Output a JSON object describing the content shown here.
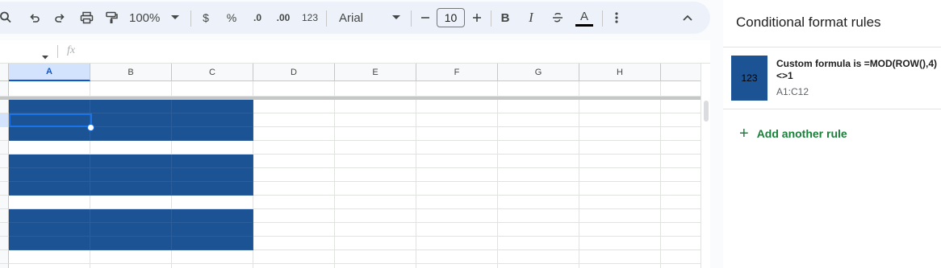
{
  "toolbar": {
    "zoom": "100%",
    "currency": "$",
    "percent": "%",
    "dec_decrease": ".0",
    "dec_increase": ".00",
    "format_number": "123",
    "font": "Arial",
    "font_size": "10",
    "bold": "B",
    "italic": "I",
    "text_color": "A"
  },
  "formula_bar": {
    "fx": "fx"
  },
  "grid": {
    "columns": [
      "A",
      "B",
      "C",
      "D",
      "E",
      "F",
      "G",
      "H"
    ],
    "selected_column": "A"
  },
  "panel": {
    "title": "Conditional format rules",
    "rule": {
      "preview_text": "123",
      "condition": "Custom formula is =MOD(ROW(),4)<>1",
      "range": "A1:C12",
      "fill_color": "#1c5395"
    },
    "add_rule": "Add another rule"
  },
  "colors": {
    "accent": "#1a73e8",
    "fill": "#1c5395",
    "add_rule": "#188038"
  }
}
